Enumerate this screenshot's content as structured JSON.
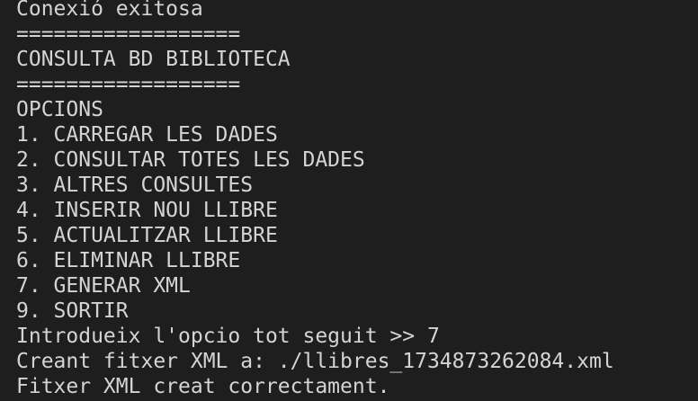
{
  "terminal": {
    "lines": [
      "Conexió exitosa",
      "==================",
      "CONSULTA BD BIBLIOTECA",
      "==================",
      "OPCIONS",
      "1. CARREGAR LES DADES",
      "2. CONSULTAR TOTES LES DADES",
      "3. ALTRES CONSULTES",
      "4. INSERIR NOU LLIBRE",
      "5. ACTUALITZAR LLIBRE",
      "6. ELIMINAR LLIBRE",
      "7. GENERAR XML",
      "9. SORTIR",
      "Introdueix l'opcio tot seguit >> 7",
      "Creant fitxer XML a: ./llibres_1734873262084.xml",
      "Fitxer XML creat correctament."
    ]
  },
  "colors": {
    "background": "#1e1e1e",
    "text": "#d4d4d4"
  }
}
